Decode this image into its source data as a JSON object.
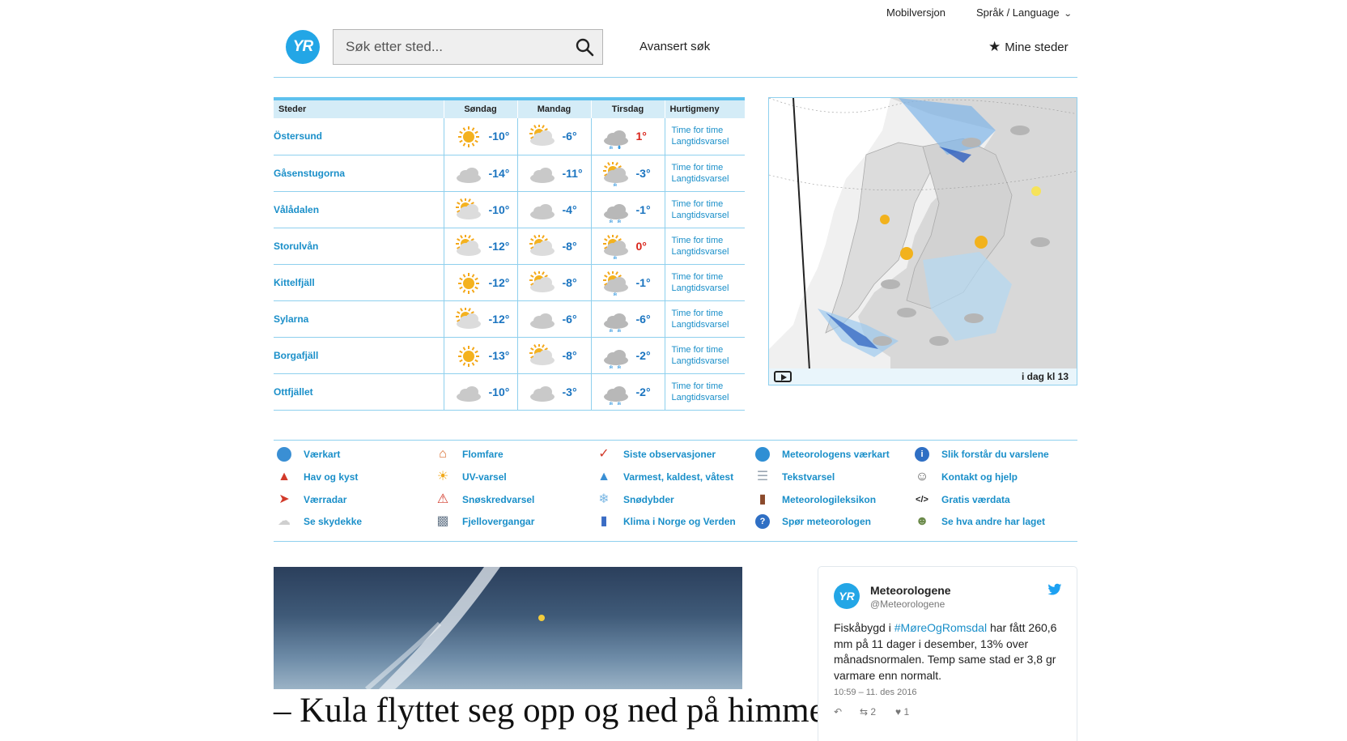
{
  "topbar": {
    "mobile": "Mobilversjon",
    "language": "Språk / Language"
  },
  "header": {
    "logo_text": "YR",
    "search_placeholder": "Søk etter sted...",
    "advanced_search": "Avansert søk",
    "my_places": "Mine steder"
  },
  "table": {
    "headers": {
      "places": "Steder",
      "days": [
        "Søndag",
        "Mandag",
        "Tirsdag"
      ],
      "quick": "Hurtigmeny"
    },
    "link_hourly": "Time for time",
    "link_long": "Langtidsvarsel",
    "rows": [
      {
        "name": "Östersund",
        "temps": [
          "-10°",
          "-6°",
          "1°"
        ],
        "icons": [
          "sun",
          "partly-sunny",
          "cloud-sleet"
        ]
      },
      {
        "name": "Gåsenstugorna",
        "temps": [
          "-14°",
          "-11°",
          "-3°"
        ],
        "icons": [
          "cloud",
          "cloud",
          "partly-sunny-snow"
        ]
      },
      {
        "name": "Vålådalen",
        "temps": [
          "-10°",
          "-4°",
          "-1°"
        ],
        "icons": [
          "partly-sunny",
          "cloud",
          "cloud-snow"
        ]
      },
      {
        "name": "Storulvån",
        "temps": [
          "-12°",
          "-8°",
          "0°"
        ],
        "icons": [
          "partly-sunny",
          "partly-sunny",
          "partly-sunny-snow"
        ]
      },
      {
        "name": "Kittelfjäll",
        "temps": [
          "-12°",
          "-8°",
          "-1°"
        ],
        "icons": [
          "sun",
          "partly-sunny",
          "partly-sunny-snow"
        ]
      },
      {
        "name": "Sylarna",
        "temps": [
          "-12°",
          "-6°",
          "-6°"
        ],
        "icons": [
          "partly-sunny",
          "cloud",
          "cloud-snow"
        ]
      },
      {
        "name": "Borgafjäll",
        "temps": [
          "-13°",
          "-8°",
          "-2°"
        ],
        "icons": [
          "sun",
          "partly-sunny",
          "cloud-snow"
        ]
      },
      {
        "name": "Ottfjället",
        "temps": [
          "-10°",
          "-3°",
          "-2°"
        ],
        "icons": [
          "cloud",
          "cloud",
          "cloud-snow"
        ]
      }
    ]
  },
  "map": {
    "time_label": "i dag kl 13"
  },
  "quicklinks": [
    [
      "Værkart",
      "Hav og kyst",
      "Værradar",
      "Se skydekke"
    ],
    [
      "Flomfare",
      "UV-varsel",
      "Snøskredvarsel",
      "Fjellovergangar"
    ],
    [
      "Siste observasjoner",
      "Varmest, kaldest, våtest",
      "Snødybder",
      "Klima i Norge og Verden"
    ],
    [
      "Meteorologens værkart",
      "Tekstvarsel",
      "Meteorologileksikon",
      "Spør meteorologen"
    ],
    [
      "Slik forstår du varslene",
      "Kontakt og hjelp",
      "Gratis værdata",
      "Se hva andre har laget"
    ]
  ],
  "article": {
    "title": "– Kula flyttet seg opp og ned på himmelen"
  },
  "tweet": {
    "name": "Meteorologene",
    "handle": "@Meteorologene",
    "text_a": "Fiskåbygd i ",
    "hashtag": "#MøreOgRomsdal",
    "text_b": " har fått 260,6 mm på 11 dager i desember, 13% over månadsnormalen. Temp same stad er 3,8 gr varmare enn normalt.",
    "date": "10:59 – 11. des 2016",
    "retweets": "2",
    "likes": "1"
  },
  "colors": {
    "accent": "#1a8fc9",
    "brand": "#23a6e6",
    "rule": "#8fd0ee",
    "header_bg": "#d4ecf7"
  }
}
